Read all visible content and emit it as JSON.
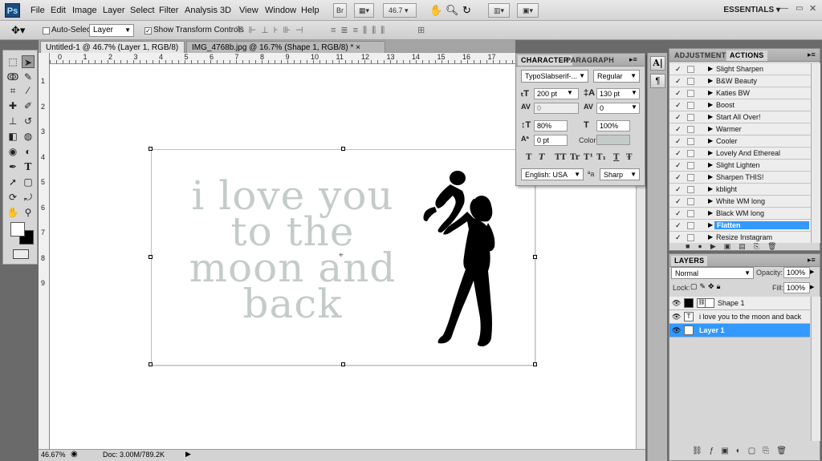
{
  "app": {
    "logo": "Ps",
    "workspace": "ESSENTIALS",
    "zoom_display": "46.7"
  },
  "menu": [
    "File",
    "Edit",
    "Image",
    "Layer",
    "Select",
    "Filter",
    "Analysis",
    "3D",
    "View",
    "Window",
    "Help"
  ],
  "menubar_buttons": {
    "bridge": "Br"
  },
  "options": {
    "auto_select_label": "Auto-Select:",
    "auto_select_value": "Layer",
    "show_transform_label": "Show Transform Controls"
  },
  "tabs": [
    {
      "label": "Untitled-1 @ 46.7% (Layer 1, RGB/8) *",
      "close": "×",
      "active": true
    },
    {
      "label": "IMG_4768b.jpg @ 16.7% (Shape 1, RGB/8) *",
      "close": "×",
      "active": false
    }
  ],
  "ruler_top": [
    "0",
    "1",
    "2",
    "3",
    "4",
    "5",
    "6",
    "7",
    "8",
    "9",
    "10",
    "11",
    "12",
    "13",
    "14",
    "15",
    "16",
    "17"
  ],
  "ruler_left": [
    "1",
    "2",
    "3",
    "4",
    "5",
    "6",
    "7",
    "8",
    "9"
  ],
  "canvas_text": {
    "line1": "i love you",
    "line2": "to the",
    "line3": "moon and",
    "line4": "back"
  },
  "status": {
    "zoom": "46.67%",
    "doc": "Doc: 3.00M/789.2K"
  },
  "character_panel": {
    "tabs": [
      "CHARACTER",
      "PARAGRAPH"
    ],
    "font_family": "TypoSlabserif-...",
    "font_style": "Regular",
    "font_size": "200 pt",
    "leading": "130 pt",
    "kerning": "0",
    "tracking": "0",
    "vertical_scale": "80%",
    "horizontal_scale": "100%",
    "baseline_shift": "0 pt",
    "color_label": "Color:",
    "text_color": "#c4ccca",
    "format_buttons": [
      "T",
      "T",
      "TT",
      "Tr",
      "T¹",
      "T₁",
      "T",
      "Ŧ"
    ],
    "language": "English: USA",
    "aa_label": "ªa",
    "antialias": "Sharp"
  },
  "actions_panel": {
    "tabs": [
      "ADJUSTMENTS",
      "ACTIONS"
    ],
    "items": [
      "Slight Sharpen",
      "B&W Beauty",
      "Katies BW",
      "Boost",
      "Start All Over!",
      "Warmer",
      "Cooler",
      "Lovely And Ethereal",
      "Slight Lighten",
      "Sharpen THIS!",
      "kblight",
      "White WM long",
      "Black WM long",
      "Flatten",
      "Resize Instagram"
    ],
    "selected": "Flatten"
  },
  "layers_panel": {
    "tab": "LAYERS",
    "blend_mode": "Normal",
    "opacity_label": "Opacity:",
    "opacity": "100%",
    "lock_label": "Lock:",
    "fill_label": "Fill:",
    "fill": "100%",
    "layers": [
      {
        "name": "Shape 1",
        "thumb": "■",
        "selected": false
      },
      {
        "name": "i love you  to the moon and back",
        "thumb": "T",
        "selected": false
      },
      {
        "name": "Layer 1",
        "thumb": "",
        "selected": true
      }
    ]
  },
  "colors": {
    "accent": "#3399ff",
    "text_gray": "#c4ccca",
    "chrome": "#d6d6d6"
  }
}
